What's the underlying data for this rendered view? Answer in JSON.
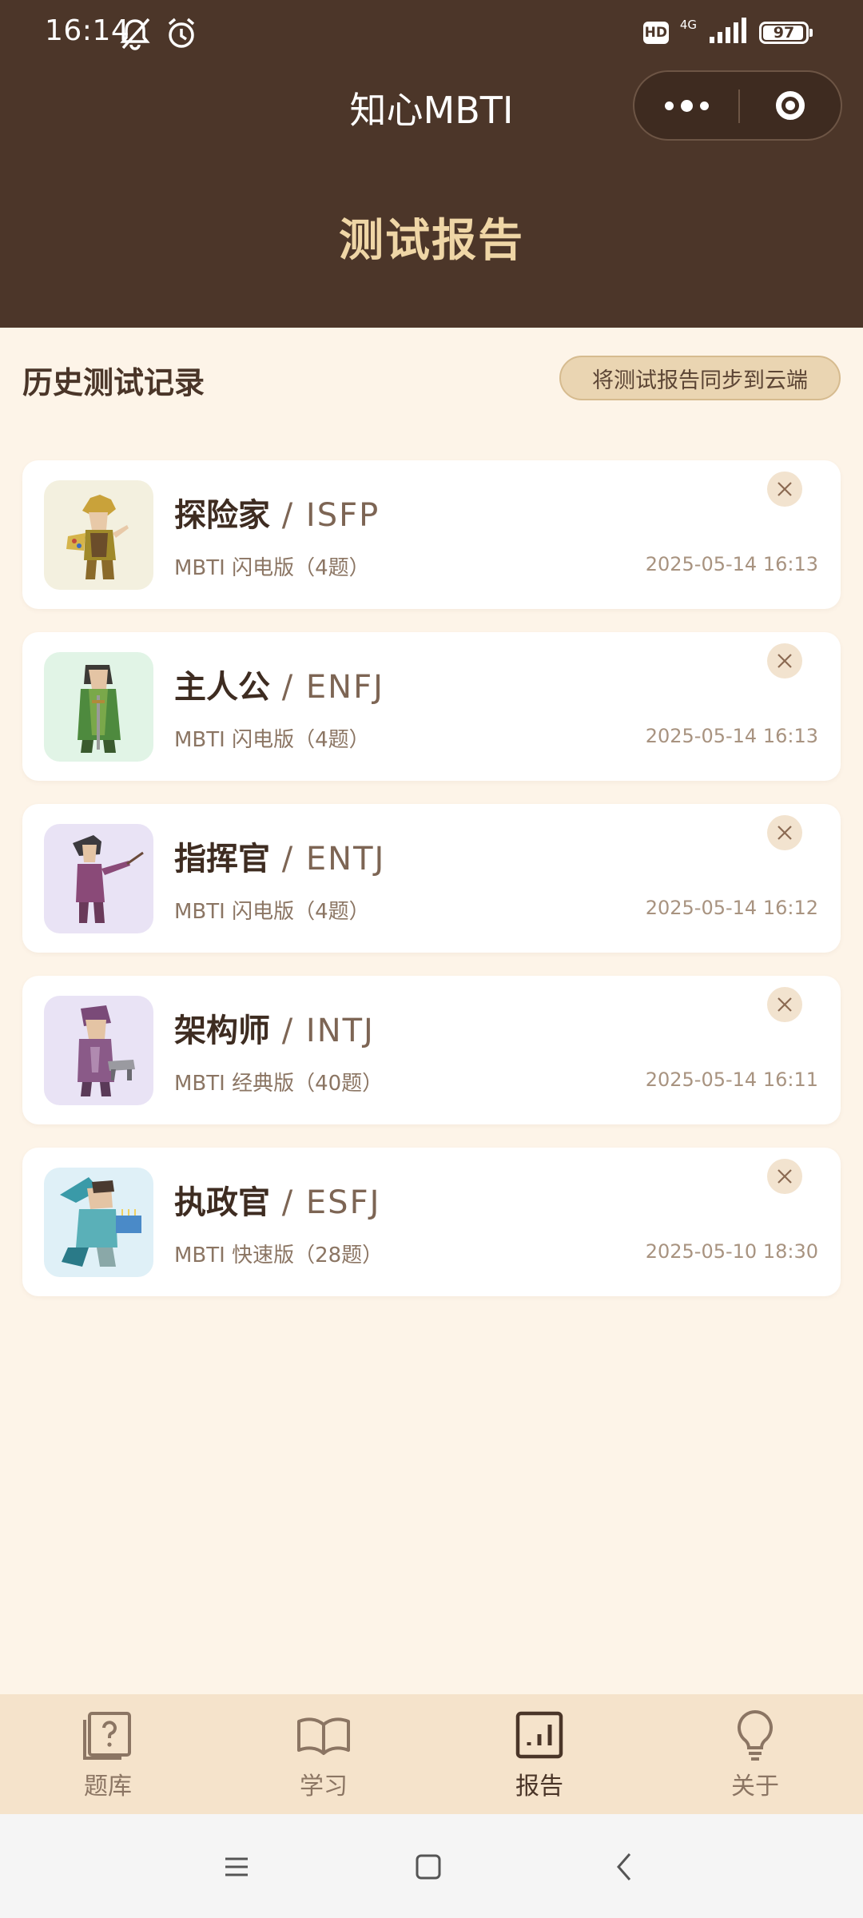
{
  "status_bar": {
    "time": "16:14",
    "hd_badge": "HD",
    "network": "4G",
    "battery": "97",
    "battery_level": 0.97
  },
  "app": {
    "title": "知心MBTI"
  },
  "page": {
    "title": "测试报告"
  },
  "section": {
    "title": "历史测试记录",
    "sync_label": "将测试报告同步到云端"
  },
  "records": [
    {
      "name": "探险家",
      "sep": " / ",
      "code": "ISFP",
      "version": "MBTI 闪电版（4题）",
      "date": "2025-05-14 16:13",
      "avatar_bg": "#f3f0df"
    },
    {
      "name": "主人公",
      "sep": " / ",
      "code": "ENFJ",
      "version": "MBTI 闪电版（4题）",
      "date": "2025-05-14 16:13",
      "avatar_bg": "#e1f4e6"
    },
    {
      "name": "指挥官",
      "sep": " / ",
      "code": "ENTJ",
      "version": "MBTI 闪电版（4题）",
      "date": "2025-05-14 16:12",
      "avatar_bg": "#e9e3f5"
    },
    {
      "name": "架构师",
      "sep": " / ",
      "code": "INTJ",
      "version": "MBTI 经典版（40题）",
      "date": "2025-05-14 16:11",
      "avatar_bg": "#e9e3f5"
    },
    {
      "name": "执政官",
      "sep": " / ",
      "code": "ESFJ",
      "version": "MBTI 快速版（28题）",
      "date": "2025-05-10 18:30",
      "avatar_bg": "#dff0f7"
    }
  ],
  "tabs": [
    {
      "label": "题库",
      "icon": "question-book-icon"
    },
    {
      "label": "学习",
      "icon": "open-book-icon"
    },
    {
      "label": "报告",
      "icon": "bar-chart-icon",
      "active": true
    },
    {
      "label": "关于",
      "icon": "lightbulb-icon"
    }
  ],
  "colors": {
    "header_bg": "#4c3629",
    "page_bg": "#fdf4e8",
    "accent_gold": "#efd6a6",
    "tabbar_bg": "#f5e3cb"
  }
}
